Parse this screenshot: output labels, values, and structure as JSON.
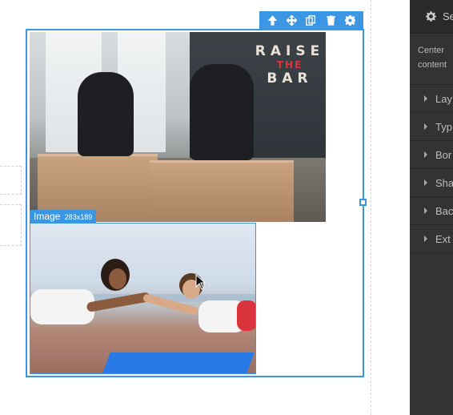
{
  "toolbar": {
    "icons": [
      "arrow-up-icon",
      "move-icon",
      "clone-icon",
      "trash-icon",
      "settings-icon"
    ]
  },
  "canvas": {
    "image_label": "Image",
    "image_size": "283x189",
    "wall_text_line1": "RAISE",
    "wall_text_line2": "THE",
    "wall_text_line3": "BAR"
  },
  "panel": {
    "header_label": "Se",
    "center_content": "Center content",
    "sectors": [
      "Lay",
      "Typ",
      "Bor",
      "Sha",
      "Bac",
      "Ext"
    ]
  },
  "colors": {
    "accent": "#3b97e3",
    "panel_bg": "#333336"
  }
}
